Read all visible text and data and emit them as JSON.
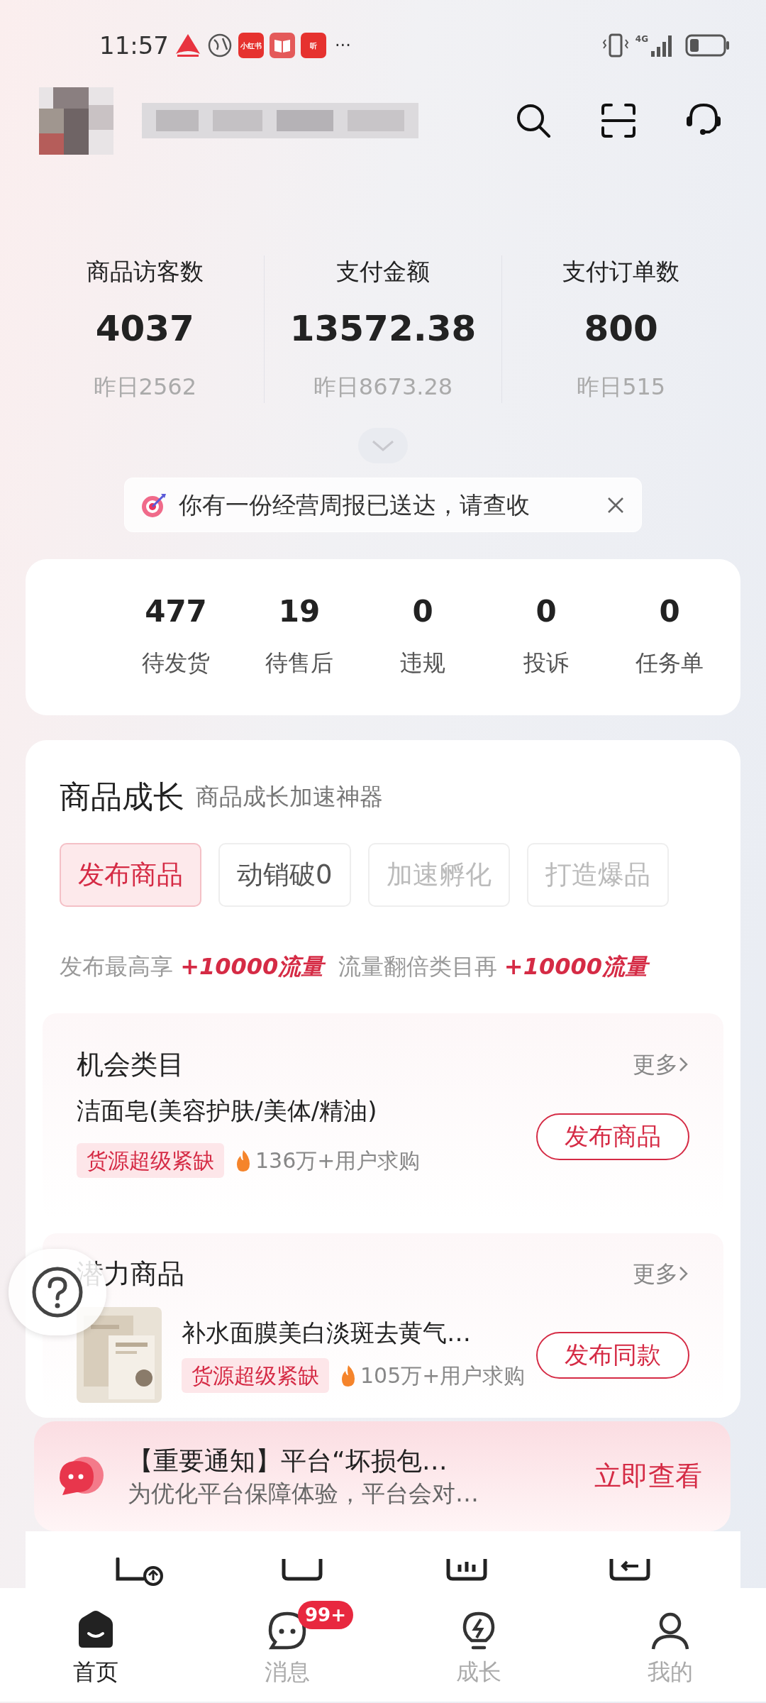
{
  "status_bar": {
    "time": "11:57",
    "notification_icons": [
      {
        "kind": "mountain"
      },
      {
        "kind": "globe"
      },
      {
        "kind": "label",
        "label": "小红书"
      },
      {
        "kind": "book"
      },
      {
        "kind": "label",
        "label": "听"
      }
    ],
    "more": "···",
    "network": "4G"
  },
  "stats": [
    {
      "label": "商品访客数",
      "value": "4037",
      "yesterday": "昨日2562"
    },
    {
      "label": "支付金额",
      "value": "13572.38",
      "yesterday": "昨日8673.28"
    },
    {
      "label": "支付订单数",
      "value": "800",
      "yesterday": "昨日515"
    }
  ],
  "notice": {
    "text": "你有一份经营周报已送达，请查收"
  },
  "counts": [
    {
      "value": "477",
      "label": "待发货"
    },
    {
      "value": "19",
      "label": "待售后"
    },
    {
      "value": "0",
      "label": "违规"
    },
    {
      "value": "0",
      "label": "投诉"
    },
    {
      "value": "0",
      "label": "任务单"
    }
  ],
  "growth": {
    "title": "商品成长",
    "subtitle": "商品成长加速神器",
    "tabs": [
      {
        "label": "发布商品",
        "selected": true,
        "disabled": false
      },
      {
        "label": "动销破0",
        "selected": false,
        "disabled": false
      },
      {
        "label": "加速孵化",
        "selected": false,
        "disabled": true
      },
      {
        "label": "打造爆品",
        "selected": false,
        "disabled": true
      }
    ],
    "promo": [
      {
        "text": "发布最高享 ",
        "highlight": false
      },
      {
        "text": "+10000流量",
        "highlight": true
      },
      {
        "text": "  流量翻倍类目再 ",
        "highlight": false
      },
      {
        "text": "+10000流量",
        "highlight": true
      }
    ]
  },
  "sections": [
    {
      "title": "机会类目",
      "more": "更多",
      "items": [
        {
          "kind": "category",
          "name": "洁面皂(美容护肤/美体/精油)",
          "tag": "货源超级紧缺",
          "demand": "136万+用户求购",
          "button": "发布商品"
        }
      ]
    },
    {
      "title": "潜力商品",
      "more": "更多",
      "items": [
        {
          "kind": "product",
          "name": "补水面膜美白淡斑去黄气…",
          "tag": "货源超级紧缺",
          "demand": "105万+用户求购",
          "button": "发布同款"
        }
      ]
    }
  ],
  "banner": {
    "title": "【重要通知】平台“坏损包…",
    "text": "为优化平台保障体验，平台会对…",
    "action": "立即查看"
  },
  "nav": [
    {
      "label": "首页",
      "selected": true
    },
    {
      "label": "消息",
      "selected": false,
      "badge": "99+"
    },
    {
      "label": "成长",
      "selected": false
    },
    {
      "label": "我的",
      "selected": false
    }
  ]
}
